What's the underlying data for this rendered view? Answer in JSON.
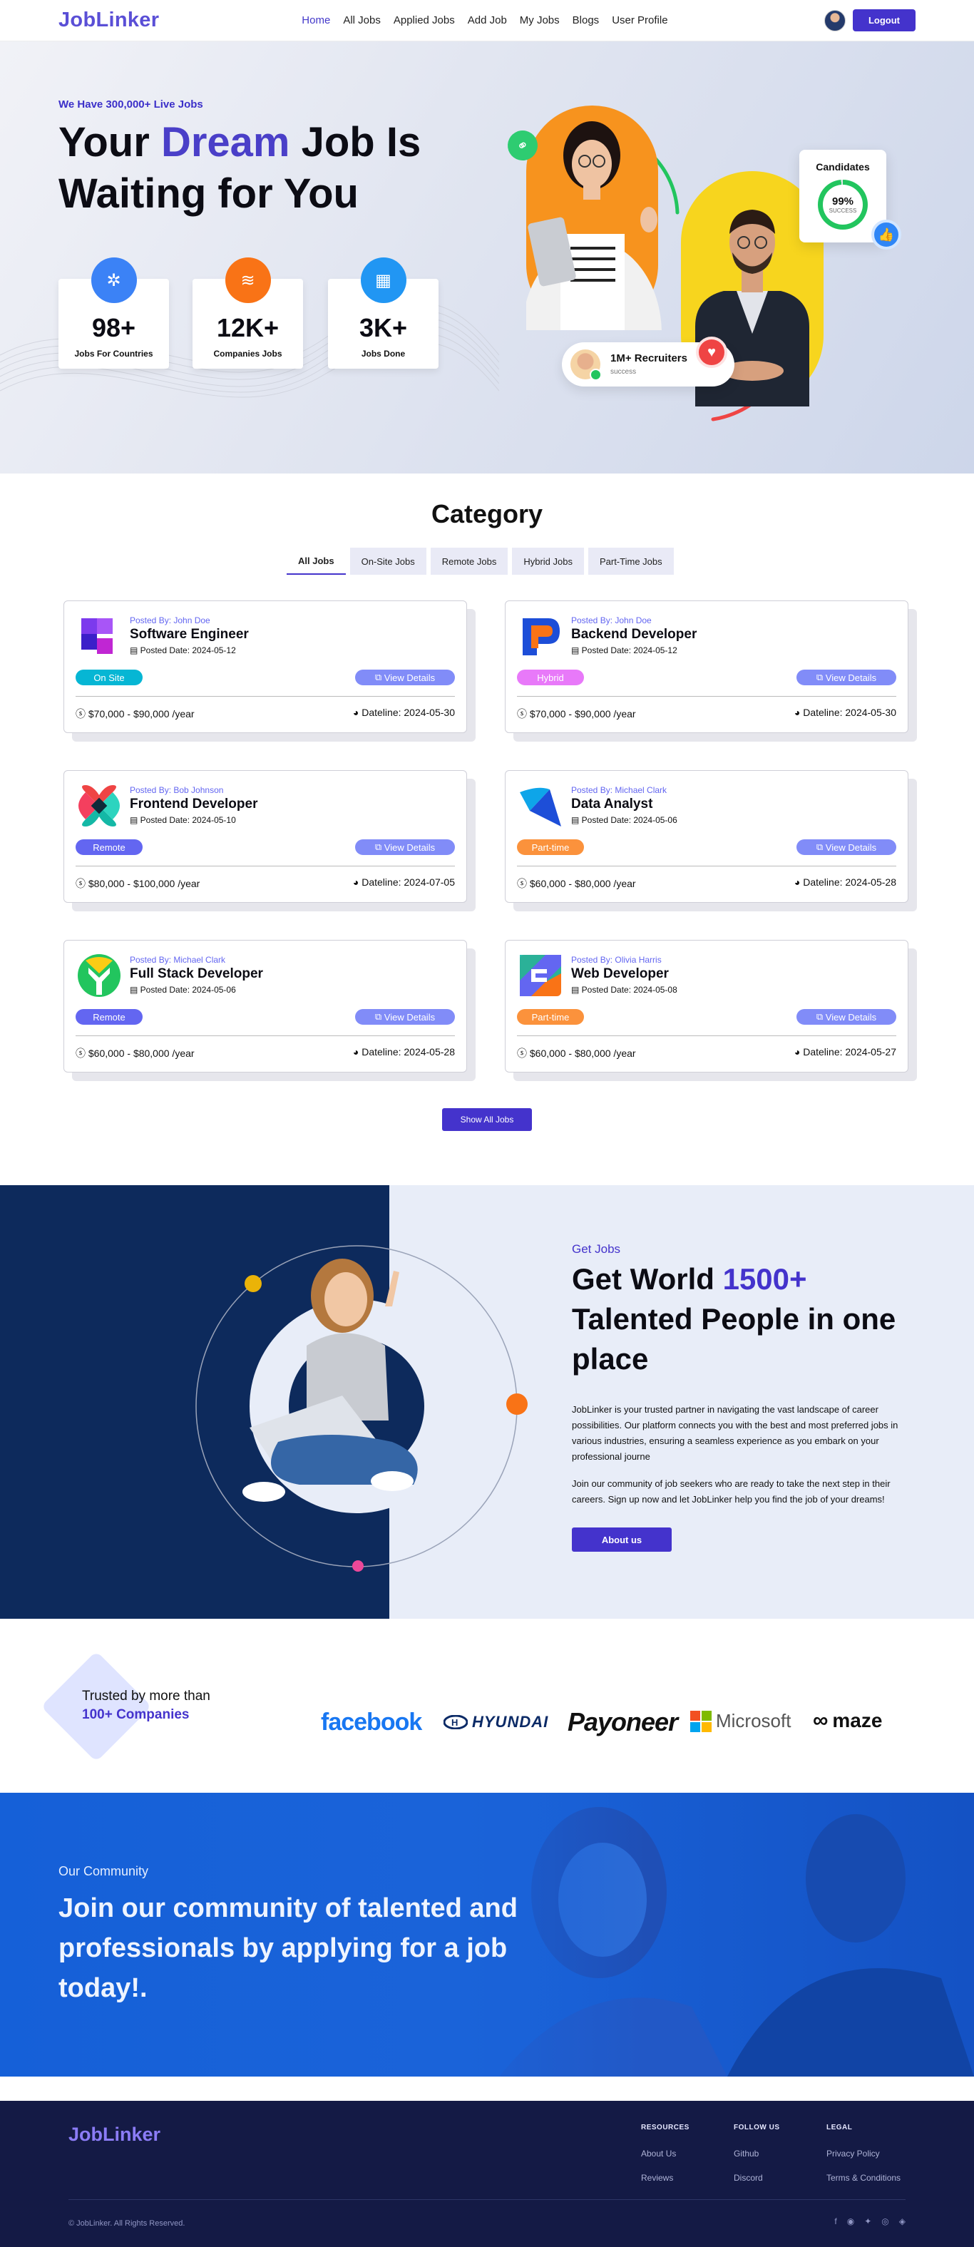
{
  "nav": {
    "logo": "JobLinker",
    "links": [
      "Home",
      "All Jobs",
      "Applied Jobs",
      "Add Job",
      "My Jobs",
      "Blogs",
      "User Profile"
    ],
    "logout": "Logout"
  },
  "hero": {
    "tag": "We Have 300,000+ Live Jobs",
    "title_1": "Your ",
    "title_accent": "Dream",
    "title_2": " Job Is",
    "title_3": "Waiting for You",
    "stats": [
      {
        "num": "98+",
        "label": "Jobs For Countries",
        "color": "#3b82f6"
      },
      {
        "num": "12K+",
        "label": "Companies Jobs",
        "color": "#f97316"
      },
      {
        "num": "3K+",
        "label": "Jobs Done",
        "color": "#2196f3"
      }
    ],
    "candidates_title": "Candidates",
    "candidates_pct": "99%",
    "candidates_sub": "SUCCESS",
    "recruiters": "1M+ Recruiters",
    "recruiters_sub": "success"
  },
  "category": {
    "title": "Category",
    "tabs": [
      "All Jobs",
      "On-Site Jobs",
      "Remote Jobs",
      "Hybrid Jobs",
      "Part-Time Jobs"
    ],
    "jobs": [
      {
        "by": "Posted By: John Doe",
        "title": "Software Engineer",
        "date": "Posted Date: 2024-05-12",
        "badge": "On Site",
        "badge_color": "#06b6d4",
        "view": "View Details",
        "salary": "$70,000 - $90,000 /year",
        "deadline": "Dateline: 2024-05-30"
      },
      {
        "by": "Posted By: John Doe",
        "title": "Backend Developer",
        "date": "Posted Date: 2024-05-12",
        "badge": "Hybrid",
        "badge_color": "#e879f9",
        "view": "View Details",
        "salary": "$70,000 - $90,000 /year",
        "deadline": "Dateline: 2024-05-30"
      },
      {
        "by": "Posted By: Bob Johnson",
        "title": "Frontend Developer",
        "date": "Posted Date: 2024-05-10",
        "badge": "Remote",
        "badge_color": "#6366f1",
        "view": "View Details",
        "salary": "$80,000 - $100,000 /year",
        "deadline": "Dateline: 2024-07-05"
      },
      {
        "by": "Posted By: Michael Clark",
        "title": "Data Analyst",
        "date": "Posted Date: 2024-05-06",
        "badge": "Part-time",
        "badge_color": "#fb923c",
        "view": "View Details",
        "salary": "$60,000 - $80,000 /year",
        "deadline": "Dateline: 2024-05-28"
      },
      {
        "by": "Posted By: Michael Clark",
        "title": "Full Stack Developer",
        "date": "Posted Date: 2024-05-06",
        "badge": "Remote",
        "badge_color": "#6366f1",
        "view": "View Details",
        "salary": "$60,000 - $80,000 /year",
        "deadline": "Dateline: 2024-05-28"
      },
      {
        "by": "Posted By: Olivia Harris",
        "title": "Web Developer",
        "date": "Posted Date: 2024-05-08",
        "badge": "Part-time",
        "badge_color": "#fb923c",
        "view": "View Details",
        "salary": "$60,000 - $80,000 /year",
        "deadline": "Dateline: 2024-05-27"
      }
    ],
    "show_all": "Show All Jobs"
  },
  "getjobs": {
    "tag": "Get Jobs",
    "title_1": "Get World ",
    "title_accent": "1500+",
    "title_2": "Talented People in one place",
    "p1": "JobLinker is your trusted partner in navigating the vast landscape of career possibilities. Our platform connects you with the best and most preferred jobs in various industries, ensuring a seamless experience as you embark on your professional journe",
    "p2": "Join our community of job seekers who are ready to take the next step in their careers. Sign up now and let JobLinker help you find the job of your dreams!",
    "button": "About us"
  },
  "trusted": {
    "line1": "Trusted by more than",
    "line2": "100+ Companies",
    "brands": [
      "facebook",
      "HYUNDAI",
      "Payoneer",
      "Microsoft",
      "maze"
    ]
  },
  "community": {
    "tag": "Our Community",
    "title": "Join our community of talented and professionals by applying for a job today!."
  },
  "footer": {
    "logo": "JobLinker",
    "cols": [
      {
        "title": "RESOURCES",
        "links": [
          "About Us",
          "Reviews"
        ]
      },
      {
        "title": "FOLLOW US",
        "links": [
          "Github",
          "Discord"
        ]
      },
      {
        "title": "LEGAL",
        "links": [
          "Privacy Policy",
          "Terms & Conditions"
        ]
      }
    ],
    "copyright": "© JobLinker. All Rights Reserved.",
    "social": [
      "f",
      "◉",
      "✦",
      "◎",
      "◈"
    ]
  }
}
